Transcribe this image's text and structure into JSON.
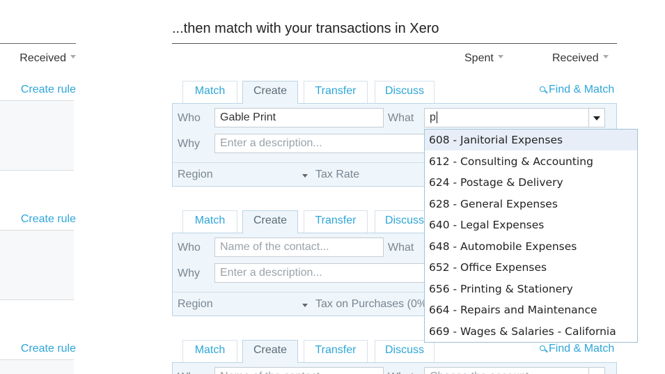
{
  "heading": "...then match with your transactions in Xero",
  "left_column": {
    "received_label": "Received",
    "create_rule_label": "Create rule"
  },
  "columns": {
    "spent": "Spent",
    "received": "Received"
  },
  "tabs": [
    "Match",
    "Create",
    "Transfer",
    "Discuss"
  ],
  "find_match_label": "Find & Match",
  "labels": {
    "who": "Who",
    "what": "What",
    "why": "Why",
    "region": "Region"
  },
  "cards": [
    {
      "who_value": "Gable Print",
      "why_placeholder": "Enter a description...",
      "what_value": "p",
      "tax_label": "Tax Rate"
    },
    {
      "who_placeholder": "Name of the contact...",
      "why_placeholder": "Enter a description...",
      "tax_label": "Tax on Purchases (0%"
    },
    {
      "who_placeholder": "Name of the contact...",
      "what_placeholder": "Choose the account..."
    }
  ],
  "account_dropdown": {
    "items": [
      "608 - Janitorial Expenses",
      "612 - Consulting & Accounting",
      "624 - Postage & Delivery",
      "628 - General Expenses",
      "640 - Legal Expenses",
      "648 - Automobile Expenses",
      "652 - Office Expenses",
      "656 - Printing & Stationery",
      "664 - Repairs and Maintenance",
      "669 - Wages & Salaries - California"
    ],
    "highlighted_index": 0
  },
  "colors": {
    "link": "#2ea6d8",
    "panel_bg": "#eef6fb",
    "panel_border": "#bcd4e4",
    "highlight": "#e8eef8"
  }
}
